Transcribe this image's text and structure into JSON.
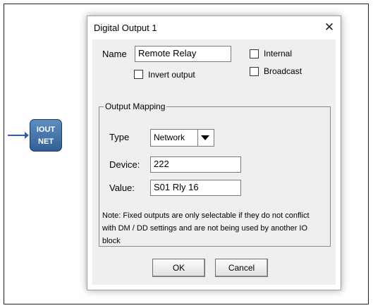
{
  "diagram": {
    "block": {
      "line1": "IOUT",
      "line2": "NET",
      "icon": "digital-output-block-icon"
    }
  },
  "dialog": {
    "title": "Digital Output 1",
    "close_glyph": "✕",
    "name": {
      "label": "Name",
      "value": "Remote Relay"
    },
    "invert_output": {
      "label": "Invert output",
      "checked": false
    },
    "internal": {
      "label": "Internal",
      "checked": false
    },
    "broadcast": {
      "label": "Broadcast",
      "checked": false
    },
    "output_mapping": {
      "legend": "Output Mapping",
      "type": {
        "label": "Type",
        "value": "Network"
      },
      "device": {
        "label": "Device:",
        "value": "222"
      },
      "value": {
        "label": "Value:",
        "value": "S01 Rly 16"
      },
      "note": "Note: Fixed outputs are only selectable if they do not conflict with DM / DD settings and are not being used by another IO block"
    },
    "buttons": {
      "ok": "OK",
      "cancel": "Cancel"
    }
  },
  "colors": {
    "wire": "#2f58c8",
    "block": "#3a6aa0",
    "dialog_bg": "#efefef"
  }
}
